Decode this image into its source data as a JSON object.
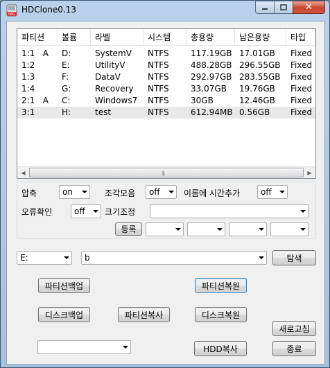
{
  "window": {
    "title": "HDClone0.13",
    "icon_text": "IMG"
  },
  "list": {
    "columns": [
      "파티션",
      "볼륨",
      "라벨",
      "시스템",
      "총용량",
      "남은용량",
      "타입"
    ],
    "rows": [
      {
        "partition": "1:1",
        "flag": "A",
        "volume": "D:",
        "label": "SystemV",
        "fs": "NTFS",
        "total": "117.19GB",
        "free": "17.01GB",
        "type": "Fixed"
      },
      {
        "partition": "1:2",
        "flag": "",
        "volume": "E:",
        "label": "UtilityV",
        "fs": "NTFS",
        "total": "488.28GB",
        "free": "296.55GB",
        "type": "Fixed"
      },
      {
        "partition": "1:3",
        "flag": "",
        "volume": "F:",
        "label": "DataV",
        "fs": "NTFS",
        "total": "292.97GB",
        "free": "283.55GB",
        "type": "Fixed"
      },
      {
        "partition": "1:4",
        "flag": "",
        "volume": "G:",
        "label": "Recovery",
        "fs": "NTFS",
        "total": "33.07GB",
        "free": "19.76GB",
        "type": "Fixed"
      },
      {
        "partition": "2:1",
        "flag": "A",
        "volume": "C:",
        "label": "Windows7",
        "fs": "NTFS",
        "total": "30GB",
        "free": "12.46GB",
        "type": "Fixed"
      },
      {
        "partition": "3:1",
        "flag": "",
        "volume": "H:",
        "label": "test",
        "fs": "NTFS",
        "total": "612.94MB",
        "free": "0.56GB",
        "type": "Fixed"
      }
    ]
  },
  "settings": {
    "compress_label": "압축",
    "compress_value": "on",
    "split_label": "조각모음",
    "split_value": "off",
    "time_label": "이름에 시간추가",
    "time_value": "off",
    "verify_label": "오류확인",
    "verify_value": "off",
    "size_label": "크기조정",
    "size_value": "",
    "register_button": "등록"
  },
  "path": {
    "drive_value": "E:",
    "path_value": "b",
    "browse_button": "탐색"
  },
  "actions": {
    "partition_backup": "파티션백업",
    "partition_restore": "파티션복원",
    "disk_backup": "디스크백업",
    "partition_copy": "파티션복사",
    "disk_restore": "디스크복원",
    "refresh": "새로고침",
    "hdd_copy": "HDD복사",
    "exit": "종료",
    "bottom_combo_value": ""
  },
  "icons": {
    "minimize": "minimize-icon",
    "maximize": "maximize-icon",
    "close": "close-icon",
    "app": "app-icon"
  }
}
